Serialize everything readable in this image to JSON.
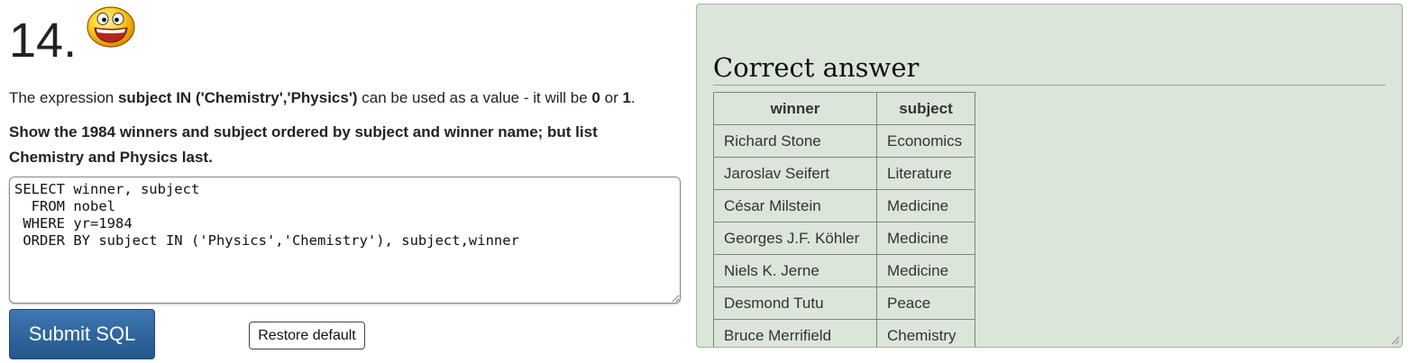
{
  "question": {
    "number": "14.",
    "icon": "smiley-face-icon",
    "intro_prefix": "The expression ",
    "intro_code": "subject IN ('Chemistry','Physics')",
    "intro_middle": " can be used as a value - it will be ",
    "intro_zero": "0",
    "intro_or": " or ",
    "intro_one": "1",
    "intro_end": ".",
    "task": "Show the 1984 winners and subject ordered by subject and winner name; but list Chemistry and Physics last."
  },
  "editor": {
    "sql": "SELECT winner, subject\n  FROM nobel\n WHERE yr=1984\n ORDER BY subject IN ('Physics','Chemistry'), subject,winner"
  },
  "buttons": {
    "submit_label": "Submit SQL",
    "restore_label": "Restore default"
  },
  "answer": {
    "title": "Correct answer",
    "columns": [
      "winner",
      "subject"
    ],
    "rows": [
      [
        "Richard Stone",
        "Economics"
      ],
      [
        "Jaroslav Seifert",
        "Literature"
      ],
      [
        "César Milstein",
        "Medicine"
      ],
      [
        "Georges J.F. Köhler",
        "Medicine"
      ],
      [
        "Niels K. Jerne",
        "Medicine"
      ],
      [
        "Desmond Tutu",
        "Peace"
      ],
      [
        "Bruce Merrifield",
        "Chemistry"
      ]
    ]
  },
  "colors": {
    "panel_bg": "#dbe5da",
    "submit_bg": "#2d6399",
    "text": "#222222"
  }
}
